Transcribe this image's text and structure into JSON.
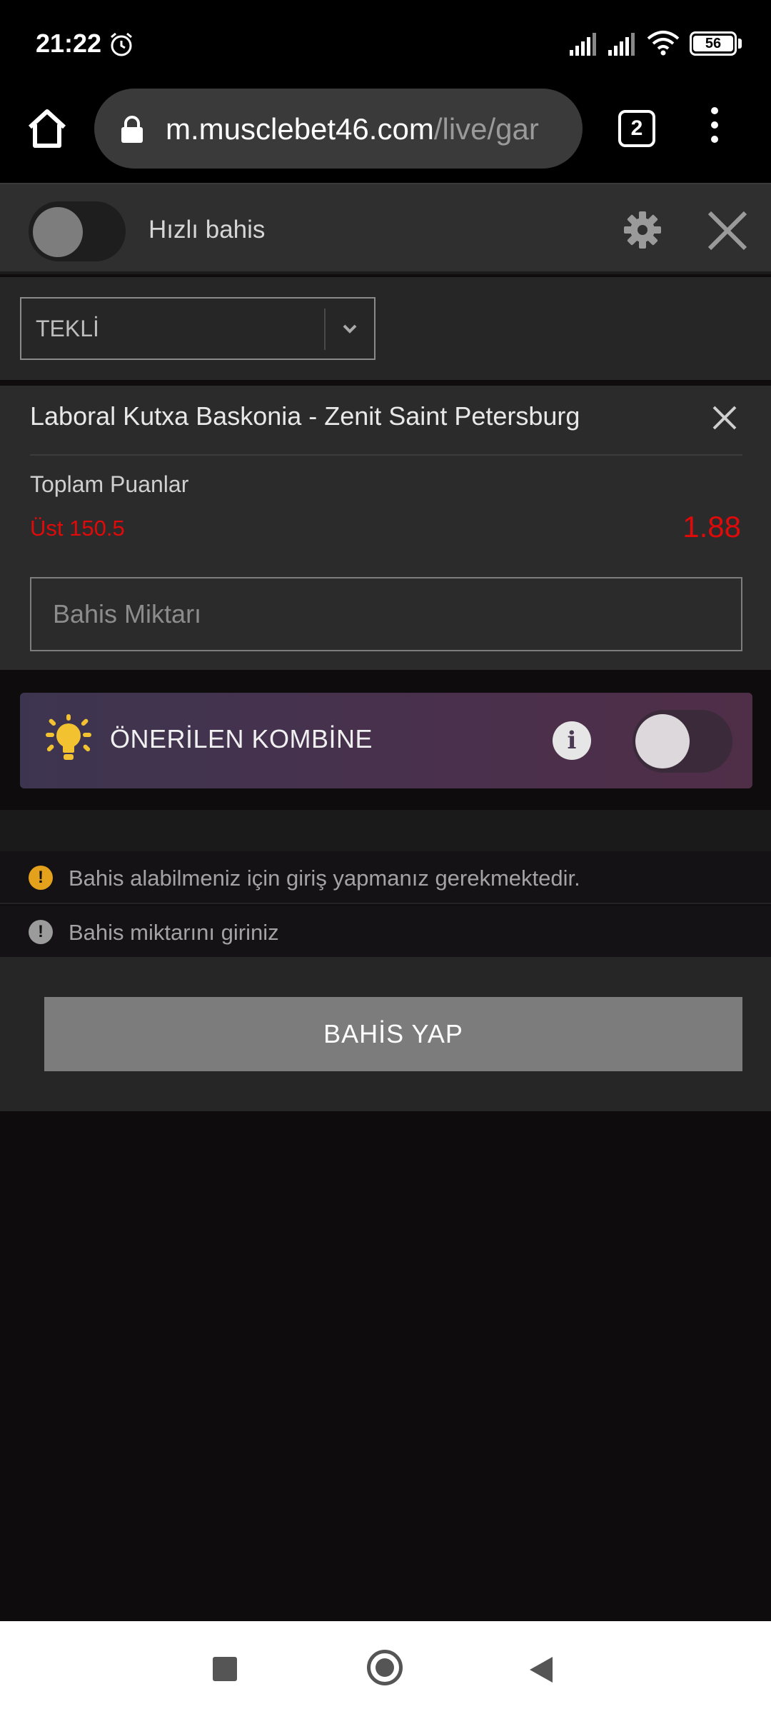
{
  "status_bar": {
    "time": "21:22",
    "battery": "56"
  },
  "browser": {
    "url_main": "m.musclebet46.com",
    "url_path": "/live/gar",
    "tab_count": "2"
  },
  "quick_bet": {
    "label": "Hızlı bahis",
    "enabled": false
  },
  "bet_type": {
    "selected": "TEKLİ"
  },
  "selection": {
    "match": "Laboral Kutxa Baskonia - Zenit Saint Petersburg",
    "market": "Toplam Puanlar",
    "outcome": "Üst 150.5",
    "odds": "1.88",
    "stake_placeholder": "Bahis Miktarı"
  },
  "combo": {
    "label": "ÖNERİLEN KOMBİNE",
    "enabled": false
  },
  "messages": [
    {
      "type": "warning",
      "text": "Bahis alabilmeniz için giriş yapmanız gerekmektedir."
    },
    {
      "type": "info",
      "text": "Bahis miktarını giriniz"
    }
  ],
  "submit": {
    "label": "BAHİS YAP"
  },
  "colors": {
    "odds_red": "#e10a0a",
    "warning": "#e4a11b",
    "bulb": "#f2c230"
  }
}
